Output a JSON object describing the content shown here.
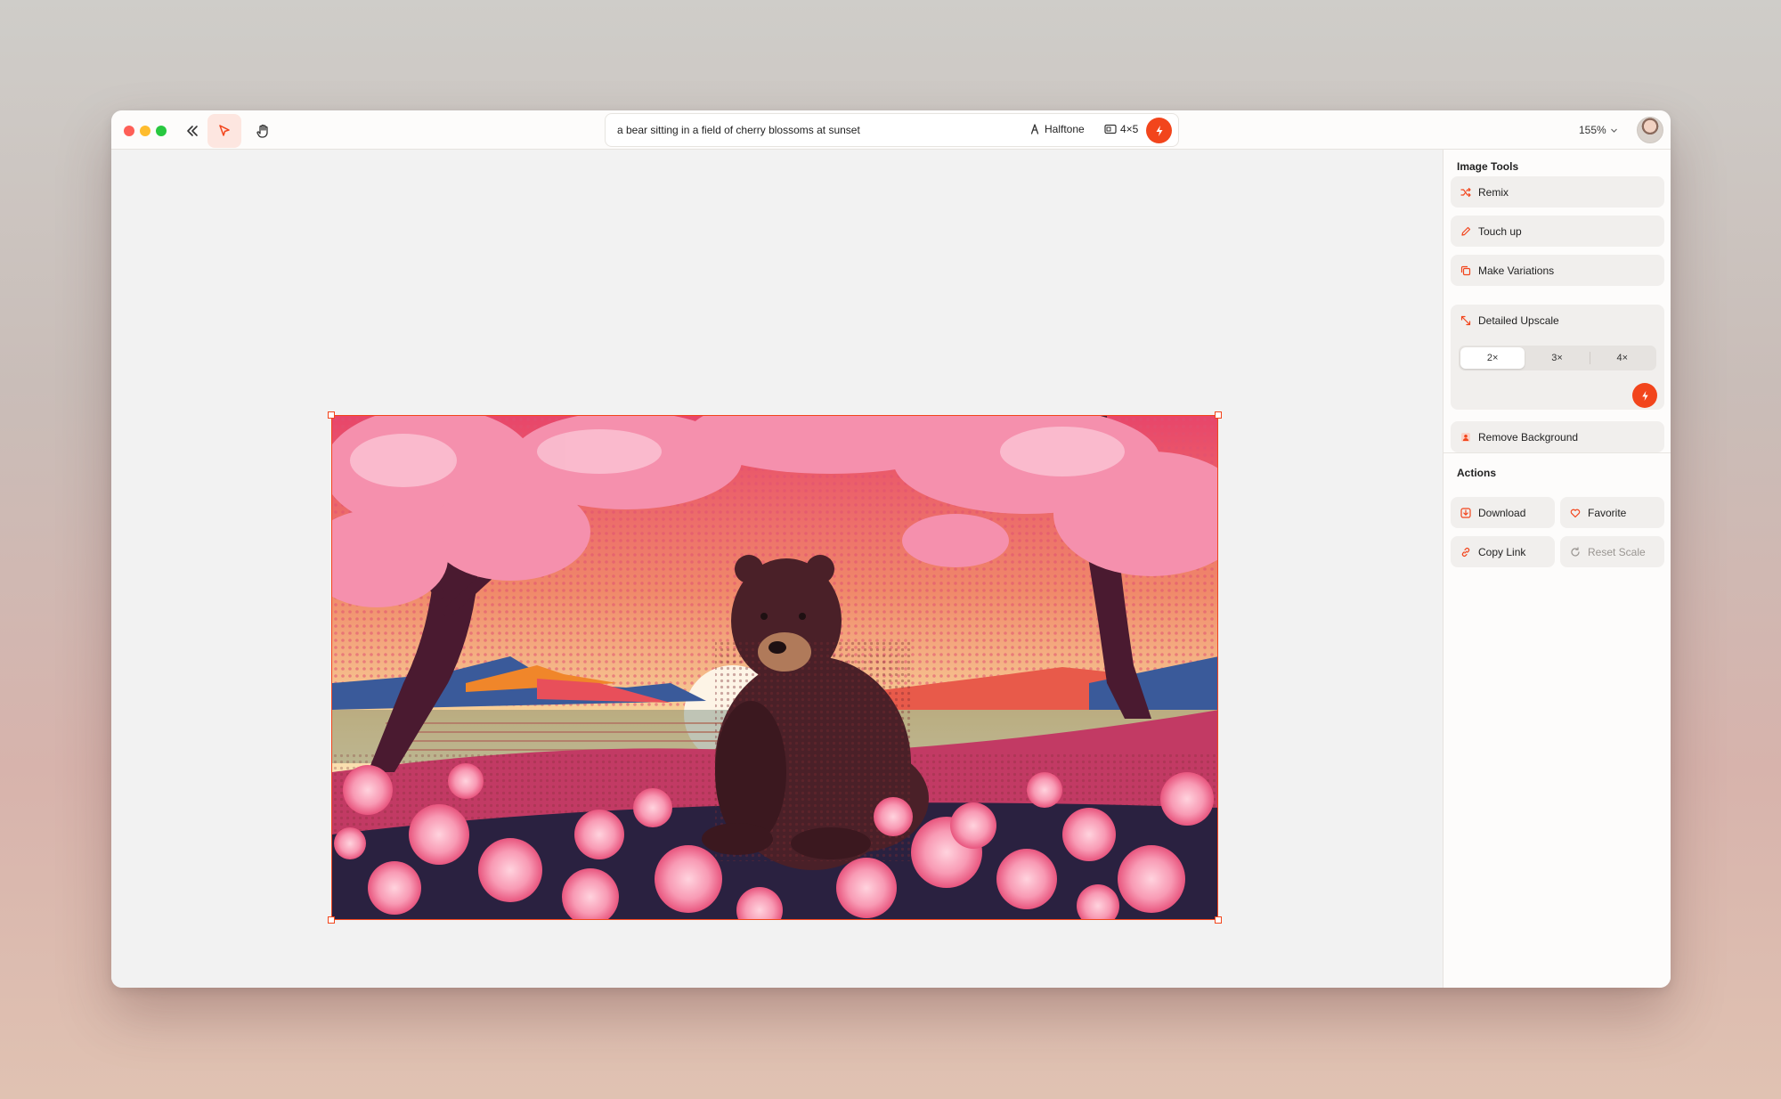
{
  "toolbar": {
    "prompt": "a bear sitting in a field of cherry blossoms at sunset",
    "style_label": "Halftone",
    "ratio_label": "4×5",
    "zoom_label": "155%"
  },
  "sidebar": {
    "image_tools_title": "Image Tools",
    "tools": {
      "remix": "Remix",
      "touch_up": "Touch up",
      "make_variations": "Make Variations",
      "detailed_upscale": "Detailed Upscale",
      "remove_background": "Remove Background"
    },
    "upscale_options": [
      "2×",
      "3×",
      "4×"
    ],
    "upscale_selected": "2×",
    "actions_title": "Actions",
    "actions": {
      "download": "Download",
      "favorite": "Favorite",
      "copy_link": "Copy Link",
      "reset_scale": "Reset Scale"
    }
  },
  "colors": {
    "accent": "#f2451c",
    "selected_tool_bg": "#fde6e0",
    "panel_button_bg": "#f1efed",
    "canvas_bg": "#f2f2f2"
  },
  "icons": {
    "collapse": "double-chevron-left-icon",
    "select": "pointer-arrow-icon",
    "pan": "hand-icon",
    "style": "brush-icon",
    "ratio": "aspect-ratio-icon",
    "generate": "lightning-icon",
    "remix": "shuffle-icon",
    "touch_up": "pencil-icon",
    "variations": "copy-icon",
    "upscale": "expand-arrows-icon",
    "remove_bg": "person-icon",
    "download": "download-icon",
    "favorite": "heart-icon",
    "copy_link": "link-icon",
    "reset_scale": "refresh-icon"
  }
}
